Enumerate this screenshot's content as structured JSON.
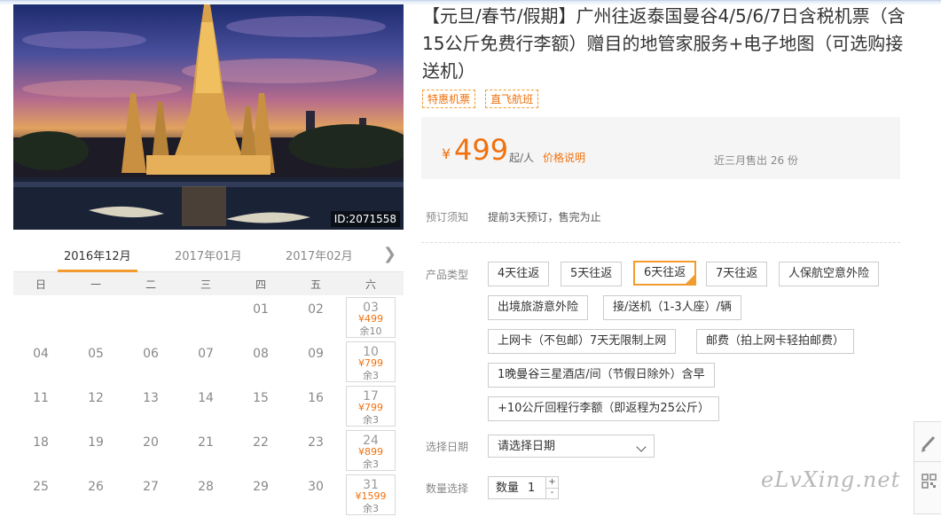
{
  "hero": {
    "image_id": "ID:2071558"
  },
  "calendar": {
    "months": [
      "2016年12月",
      "2017年01月",
      "2017年02月"
    ],
    "weekdays": [
      "日",
      "一",
      "二",
      "三",
      "四",
      "五",
      "六"
    ],
    "weeks": [
      [
        {
          "d": ""
        },
        {
          "d": ""
        },
        {
          "d": ""
        },
        {
          "d": ""
        },
        {
          "d": "01"
        },
        {
          "d": "02"
        },
        {
          "d": "03",
          "price": "¥499",
          "left": "余10"
        }
      ],
      [
        {
          "d": "04"
        },
        {
          "d": "05"
        },
        {
          "d": "06"
        },
        {
          "d": "07"
        },
        {
          "d": "08"
        },
        {
          "d": "09"
        },
        {
          "d": "10",
          "price": "¥799",
          "left": "余3"
        }
      ],
      [
        {
          "d": "11"
        },
        {
          "d": "12"
        },
        {
          "d": "13"
        },
        {
          "d": "14"
        },
        {
          "d": "15"
        },
        {
          "d": "16"
        },
        {
          "d": "17",
          "price": "¥799",
          "left": "余3"
        }
      ],
      [
        {
          "d": "18"
        },
        {
          "d": "19"
        },
        {
          "d": "20"
        },
        {
          "d": "21"
        },
        {
          "d": "22"
        },
        {
          "d": "23"
        },
        {
          "d": "24",
          "price": "¥899",
          "left": "余3"
        }
      ],
      [
        {
          "d": "25"
        },
        {
          "d": "26"
        },
        {
          "d": "27"
        },
        {
          "d": "28"
        },
        {
          "d": "29"
        },
        {
          "d": "30"
        },
        {
          "d": "31",
          "price": "¥1599",
          "left": "余3"
        }
      ]
    ]
  },
  "product": {
    "title": "【元旦/春节/假期】广州往返泰国曼谷4/5/6/7日含税机票（含15公斤免费行李额）赠目的地管家服务+电子地图（可选购接送机）",
    "tags": [
      "特惠机票",
      "直飞航班"
    ],
    "currency": "¥",
    "price": "499",
    "per": "起/人",
    "price_note": "价格说明",
    "sold": "近三月售出 26 份"
  },
  "booking": {
    "notice_label": "预订须知",
    "notice_text": "提前3天预订，售完为止",
    "type_label": "产品类型",
    "options": [
      "4天往返",
      "5天往返",
      "6天往返",
      "7天往返",
      "人保航空意外险",
      "出境旅游意外险",
      "接/送机（1-3人座）/辆",
      "上网卡（不包邮）7天无限制上网",
      "邮费（拍上网卡轻拍邮费）",
      "1晚曼谷三星酒店/间（节假日除外）含早",
      "+10公斤回程行李额（即返程为25公斤）"
    ],
    "selected_option": "6天往返",
    "date_label": "选择日期",
    "date_placeholder": "请选择日期",
    "qty_label": "数量选择",
    "qty_inner_label": "数量",
    "qty_value": "1",
    "plus": "+",
    "minus": "-"
  },
  "watermark": "eLvXing.net",
  "colors": {
    "accent": "#f39b2f",
    "price": "#f0710e"
  }
}
